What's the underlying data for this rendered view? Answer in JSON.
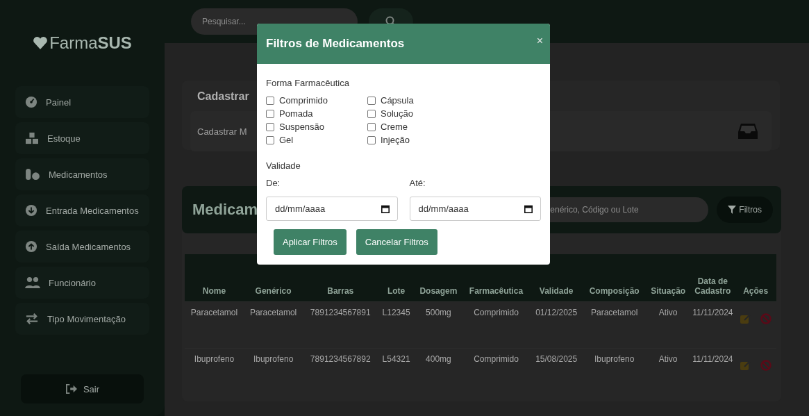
{
  "sidebar": {
    "logo": {
      "light": "Farma",
      "bold": "SUS"
    },
    "items": [
      {
        "label": "Painel"
      },
      {
        "label": "Estoque"
      },
      {
        "label": "Medicamentos"
      },
      {
        "label": "Entrada Medicamentos"
      },
      {
        "label": "Saída Medicamentos"
      },
      {
        "label": "Funcionário"
      },
      {
        "label": "Tipo Movimentação"
      }
    ],
    "logout": "Sair"
  },
  "header": {
    "search": {
      "placeholder": "Pesquisar..."
    }
  },
  "register_card": {
    "title": "Cadastrar",
    "subtitle": "Cadastrar M"
  },
  "medicines_panel": {
    "title": "Medicam",
    "search": {
      "placeholder": "enérico, Código ou Lote"
    },
    "filter_button": "Filtros"
  },
  "table": {
    "columns": [
      "Nome",
      "Genérico",
      "Barras",
      "Lote",
      "Dosagem",
      "Farmacêutica",
      "Validade",
      "Composição",
      "Situação",
      "Data de Cadastro",
      "Ações"
    ],
    "rows": [
      {
        "cells": [
          "Paracetamol",
          "Paracetamol",
          "7891234567891",
          "L12345",
          "500mg",
          "Comprimido",
          "01/12/2025",
          "Paracetamol",
          "Ativo",
          "11/11/2024"
        ]
      },
      {
        "cells": [
          "Ibuprofeno",
          "Ibuprofeno",
          "7891234567892",
          "L54321",
          "400mg",
          "Comprimido",
          "15/08/2025",
          "Ibuprofeno",
          "Ativo",
          "11/11/2024"
        ]
      }
    ]
  },
  "modal": {
    "title": "Filtros de Medicamentos",
    "close": "×",
    "form_label": "Forma Farmacêutica",
    "options": [
      {
        "label": "Comprimido",
        "checked": false
      },
      {
        "label": "Cápsula",
        "checked": false
      },
      {
        "label": "Pomada",
        "checked": false
      },
      {
        "label": "Solução",
        "checked": false
      },
      {
        "label": "Suspensão",
        "checked": false
      },
      {
        "label": "Creme",
        "checked": false
      },
      {
        "label": "Gel",
        "checked": false
      },
      {
        "label": "Injeção",
        "checked": false
      }
    ],
    "validity_label": "Validade",
    "from": {
      "label": "De:",
      "placeholder": "dd/mm/aaaa"
    },
    "to": {
      "label": "Até:",
      "placeholder": "dd/mm/aaaa"
    },
    "buttons": [
      "Aplicar Filtros",
      "Cancelar Filtros"
    ]
  }
}
